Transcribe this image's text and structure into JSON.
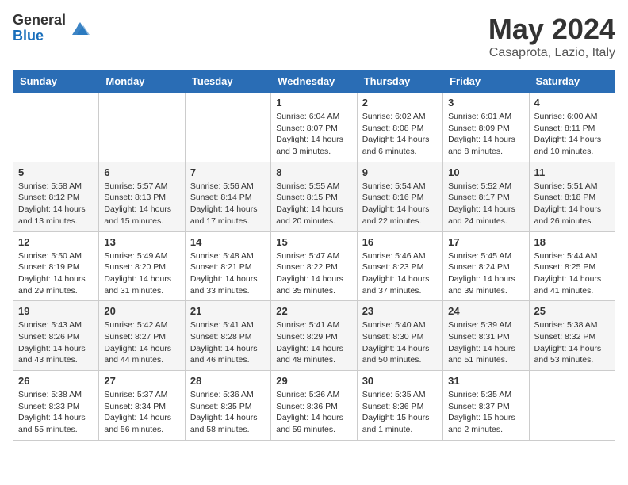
{
  "header": {
    "logo_general": "General",
    "logo_blue": "Blue",
    "title": "May 2024",
    "subtitle": "Casaprota, Lazio, Italy"
  },
  "weekdays": [
    "Sunday",
    "Monday",
    "Tuesday",
    "Wednesday",
    "Thursday",
    "Friday",
    "Saturday"
  ],
  "weeks": [
    [
      {
        "day": "",
        "detail": ""
      },
      {
        "day": "",
        "detail": ""
      },
      {
        "day": "",
        "detail": ""
      },
      {
        "day": "1",
        "detail": "Sunrise: 6:04 AM\nSunset: 8:07 PM\nDaylight: 14 hours\nand 3 minutes."
      },
      {
        "day": "2",
        "detail": "Sunrise: 6:02 AM\nSunset: 8:08 PM\nDaylight: 14 hours\nand 6 minutes."
      },
      {
        "day": "3",
        "detail": "Sunrise: 6:01 AM\nSunset: 8:09 PM\nDaylight: 14 hours\nand 8 minutes."
      },
      {
        "day": "4",
        "detail": "Sunrise: 6:00 AM\nSunset: 8:11 PM\nDaylight: 14 hours\nand 10 minutes."
      }
    ],
    [
      {
        "day": "5",
        "detail": "Sunrise: 5:58 AM\nSunset: 8:12 PM\nDaylight: 14 hours\nand 13 minutes."
      },
      {
        "day": "6",
        "detail": "Sunrise: 5:57 AM\nSunset: 8:13 PM\nDaylight: 14 hours\nand 15 minutes."
      },
      {
        "day": "7",
        "detail": "Sunrise: 5:56 AM\nSunset: 8:14 PM\nDaylight: 14 hours\nand 17 minutes."
      },
      {
        "day": "8",
        "detail": "Sunrise: 5:55 AM\nSunset: 8:15 PM\nDaylight: 14 hours\nand 20 minutes."
      },
      {
        "day": "9",
        "detail": "Sunrise: 5:54 AM\nSunset: 8:16 PM\nDaylight: 14 hours\nand 22 minutes."
      },
      {
        "day": "10",
        "detail": "Sunrise: 5:52 AM\nSunset: 8:17 PM\nDaylight: 14 hours\nand 24 minutes."
      },
      {
        "day": "11",
        "detail": "Sunrise: 5:51 AM\nSunset: 8:18 PM\nDaylight: 14 hours\nand 26 minutes."
      }
    ],
    [
      {
        "day": "12",
        "detail": "Sunrise: 5:50 AM\nSunset: 8:19 PM\nDaylight: 14 hours\nand 29 minutes."
      },
      {
        "day": "13",
        "detail": "Sunrise: 5:49 AM\nSunset: 8:20 PM\nDaylight: 14 hours\nand 31 minutes."
      },
      {
        "day": "14",
        "detail": "Sunrise: 5:48 AM\nSunset: 8:21 PM\nDaylight: 14 hours\nand 33 minutes."
      },
      {
        "day": "15",
        "detail": "Sunrise: 5:47 AM\nSunset: 8:22 PM\nDaylight: 14 hours\nand 35 minutes."
      },
      {
        "day": "16",
        "detail": "Sunrise: 5:46 AM\nSunset: 8:23 PM\nDaylight: 14 hours\nand 37 minutes."
      },
      {
        "day": "17",
        "detail": "Sunrise: 5:45 AM\nSunset: 8:24 PM\nDaylight: 14 hours\nand 39 minutes."
      },
      {
        "day": "18",
        "detail": "Sunrise: 5:44 AM\nSunset: 8:25 PM\nDaylight: 14 hours\nand 41 minutes."
      }
    ],
    [
      {
        "day": "19",
        "detail": "Sunrise: 5:43 AM\nSunset: 8:26 PM\nDaylight: 14 hours\nand 43 minutes."
      },
      {
        "day": "20",
        "detail": "Sunrise: 5:42 AM\nSunset: 8:27 PM\nDaylight: 14 hours\nand 44 minutes."
      },
      {
        "day": "21",
        "detail": "Sunrise: 5:41 AM\nSunset: 8:28 PM\nDaylight: 14 hours\nand 46 minutes."
      },
      {
        "day": "22",
        "detail": "Sunrise: 5:41 AM\nSunset: 8:29 PM\nDaylight: 14 hours\nand 48 minutes."
      },
      {
        "day": "23",
        "detail": "Sunrise: 5:40 AM\nSunset: 8:30 PM\nDaylight: 14 hours\nand 50 minutes."
      },
      {
        "day": "24",
        "detail": "Sunrise: 5:39 AM\nSunset: 8:31 PM\nDaylight: 14 hours\nand 51 minutes."
      },
      {
        "day": "25",
        "detail": "Sunrise: 5:38 AM\nSunset: 8:32 PM\nDaylight: 14 hours\nand 53 minutes."
      }
    ],
    [
      {
        "day": "26",
        "detail": "Sunrise: 5:38 AM\nSunset: 8:33 PM\nDaylight: 14 hours\nand 55 minutes."
      },
      {
        "day": "27",
        "detail": "Sunrise: 5:37 AM\nSunset: 8:34 PM\nDaylight: 14 hours\nand 56 minutes."
      },
      {
        "day": "28",
        "detail": "Sunrise: 5:36 AM\nSunset: 8:35 PM\nDaylight: 14 hours\nand 58 minutes."
      },
      {
        "day": "29",
        "detail": "Sunrise: 5:36 AM\nSunset: 8:36 PM\nDaylight: 14 hours\nand 59 minutes."
      },
      {
        "day": "30",
        "detail": "Sunrise: 5:35 AM\nSunset: 8:36 PM\nDaylight: 15 hours\nand 1 minute."
      },
      {
        "day": "31",
        "detail": "Sunrise: 5:35 AM\nSunset: 8:37 PM\nDaylight: 15 hours\nand 2 minutes."
      },
      {
        "day": "",
        "detail": ""
      }
    ]
  ]
}
